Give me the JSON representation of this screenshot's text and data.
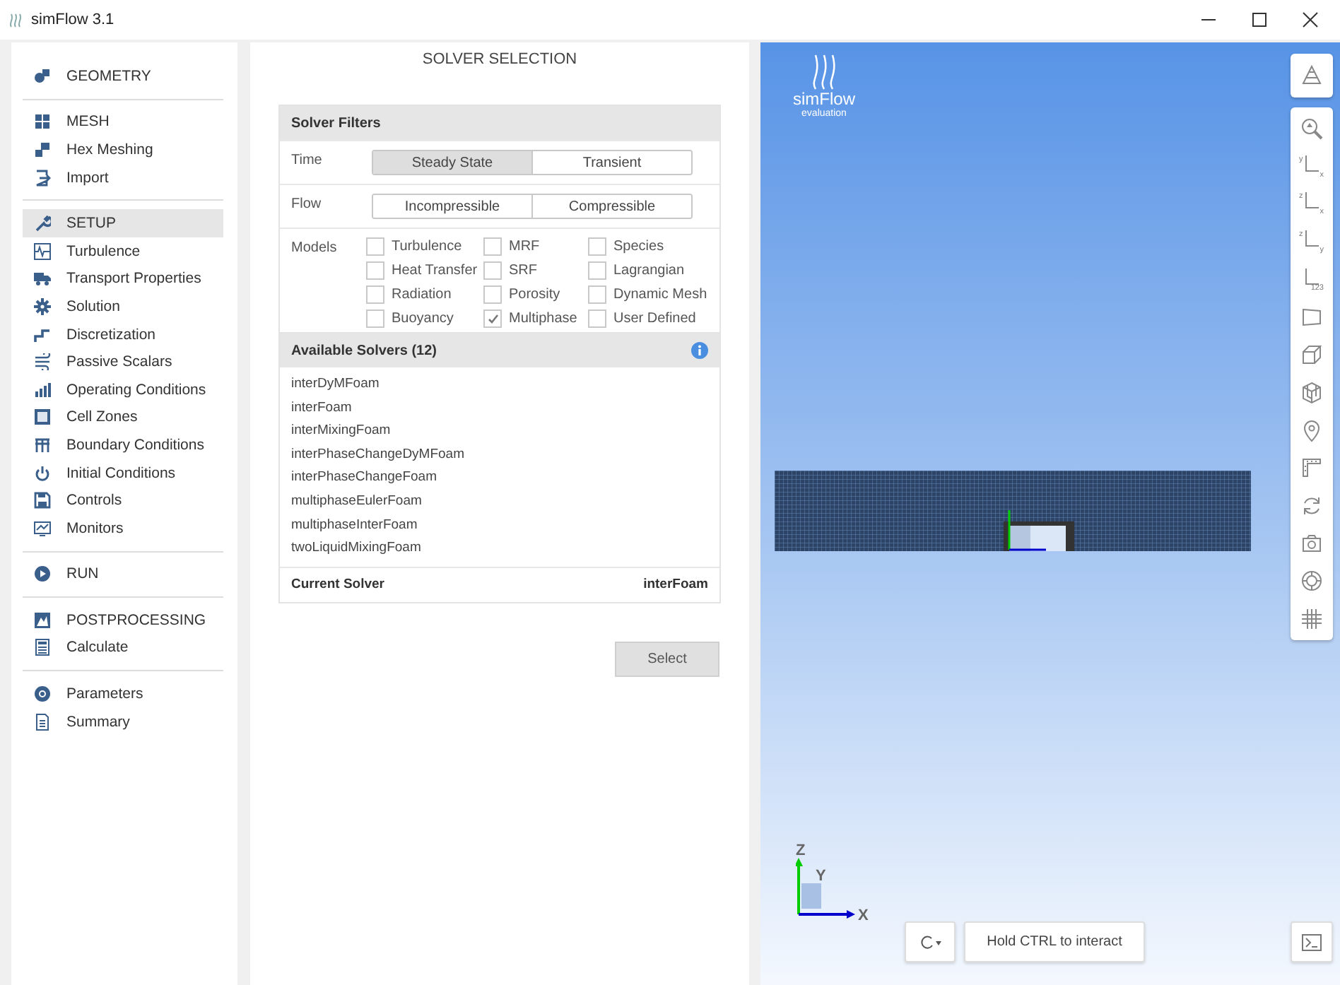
{
  "window": {
    "title": "simFlow 3.1"
  },
  "sidebar": {
    "groups": [
      {
        "items": [
          {
            "label": "GEOMETRY",
            "kind": "geometry",
            "selected": false
          }
        ]
      },
      {
        "items": [
          {
            "label": "MESH",
            "kind": "mesh",
            "selected": false
          },
          {
            "label": "Hex Meshing",
            "kind": "hex",
            "selected": false
          },
          {
            "label": "Import",
            "kind": "import",
            "selected": false
          }
        ]
      },
      {
        "items": [
          {
            "label": "SETUP",
            "kind": "wrench",
            "selected": true
          },
          {
            "label": "Turbulence",
            "kind": "wave",
            "selected": false
          },
          {
            "label": "Transport Properties",
            "kind": "truck",
            "selected": false
          },
          {
            "label": "Solution",
            "kind": "gear",
            "selected": false
          },
          {
            "label": "Discretization",
            "kind": "steps",
            "selected": false
          },
          {
            "label": "Passive Scalars",
            "kind": "wind",
            "selected": false
          },
          {
            "label": "Operating Conditions",
            "kind": "bars",
            "selected": false
          },
          {
            "label": "Cell Zones",
            "kind": "zone",
            "selected": false
          },
          {
            "label": "Boundary Conditions",
            "kind": "fence",
            "selected": false
          },
          {
            "label": "Initial Conditions",
            "kind": "power",
            "selected": false
          },
          {
            "label": "Controls",
            "kind": "save",
            "selected": false
          },
          {
            "label": "Monitors",
            "kind": "monitor",
            "selected": false
          }
        ]
      },
      {
        "items": [
          {
            "label": "RUN",
            "kind": "play",
            "selected": false
          }
        ]
      },
      {
        "items": [
          {
            "label": "POSTPROCESSING",
            "kind": "post",
            "selected": false
          },
          {
            "label": "Calculate",
            "kind": "calc",
            "selected": false
          }
        ]
      },
      {
        "items": [
          {
            "label": "Parameters",
            "kind": "at",
            "selected": false
          },
          {
            "label": "Summary",
            "kind": "doc",
            "selected": false
          }
        ]
      }
    ]
  },
  "panel": {
    "title": "SOLVER SELECTION",
    "filters": {
      "title": "Solver Filters",
      "time": {
        "label": "Time",
        "options": [
          {
            "label": "Steady State",
            "selected": true
          },
          {
            "label": "Transient",
            "selected": false
          }
        ]
      },
      "flow": {
        "label": "Flow",
        "options": [
          {
            "label": "Incompressible",
            "selected": false
          },
          {
            "label": "Compressible",
            "selected": false
          }
        ]
      },
      "models": {
        "label": "Models",
        "items": [
          {
            "label": "Turbulence",
            "checked": false
          },
          {
            "label": "MRF",
            "checked": false
          },
          {
            "label": "Species",
            "checked": false
          },
          {
            "label": "Heat Transfer",
            "checked": false
          },
          {
            "label": "SRF",
            "checked": false
          },
          {
            "label": "Lagrangian",
            "checked": false
          },
          {
            "label": "Radiation",
            "checked": false
          },
          {
            "label": "Porosity",
            "checked": false
          },
          {
            "label": "Dynamic Mesh",
            "checked": false
          },
          {
            "label": "Buoyancy",
            "checked": false
          },
          {
            "label": "Multiphase",
            "checked": true
          },
          {
            "label": "User Defined",
            "checked": false
          }
        ]
      }
    },
    "solvers": {
      "title": "Available Solvers (12)",
      "items": [
        {
          "label": "interDyMFoam",
          "selected": false
        },
        {
          "label": "interFoam",
          "selected": false
        },
        {
          "label": "interMixingFoam",
          "selected": false
        },
        {
          "label": "interPhaseChangeDyMFoam",
          "selected": false
        },
        {
          "label": "interPhaseChangeFoam",
          "selected": false
        },
        {
          "label": "multiphaseEulerFoam",
          "selected": false
        },
        {
          "label": "multiphaseInterFoam",
          "selected": false
        },
        {
          "label": "twoLiquidMixingFoam",
          "selected": false
        }
      ],
      "current_label": "Current Solver",
      "current_value": "interFoam"
    },
    "select_button": "Select"
  },
  "viewport": {
    "logo": {
      "name": "simFlow",
      "subtitle": "evaluation"
    },
    "tools": [
      {
        "kind": "pyramid"
      },
      {
        "kind": "zoom"
      },
      {
        "kind": "axes",
        "labels": [
          "y",
          "x"
        ]
      },
      {
        "kind": "axes",
        "labels": [
          "z",
          "x"
        ]
      },
      {
        "kind": "axes",
        "labels": [
          "z",
          "y"
        ]
      },
      {
        "kind": "axes",
        "labels": [
          "123"
        ]
      },
      {
        "kind": "plane"
      },
      {
        "kind": "box"
      },
      {
        "kind": "cube"
      },
      {
        "kind": "pin"
      },
      {
        "kind": "ruler"
      },
      {
        "kind": "refresh"
      },
      {
        "kind": "camera"
      },
      {
        "kind": "ring"
      },
      {
        "kind": "grid"
      }
    ],
    "triad": {
      "z": "Z",
      "y": "Y",
      "x": "X"
    },
    "interact_button": "Hold CTRL to interact"
  }
}
